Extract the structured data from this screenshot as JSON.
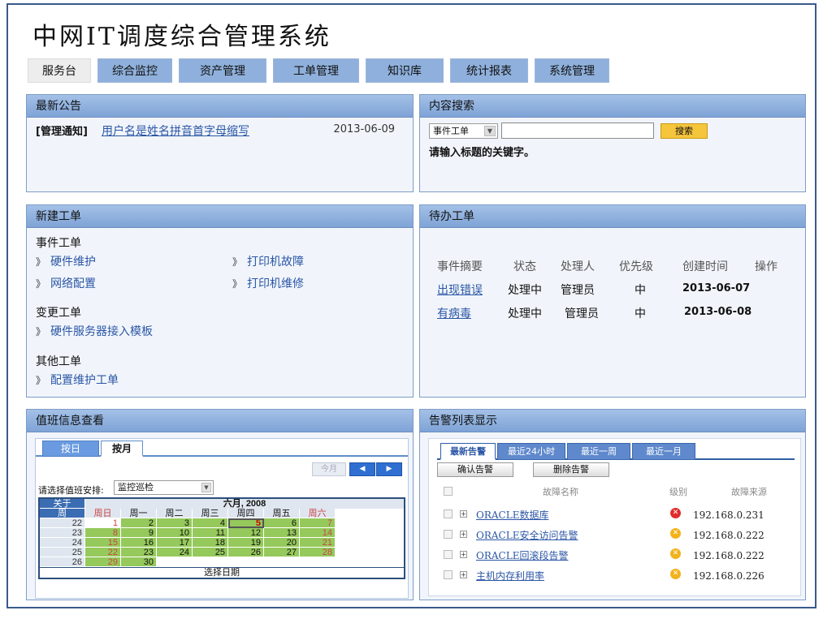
{
  "app_title": "中网IT调度综合管理系统",
  "nav": [
    "服务台",
    "综合监控",
    "资产管理",
    "工单管理",
    "知识库",
    "统计报表",
    "系统管理"
  ],
  "notice": {
    "title": "最新公告",
    "tag": "[管理通知]",
    "link": "用户名是姓名拼音首字母缩写",
    "date": "2013-06-09"
  },
  "search": {
    "title": "内容搜索",
    "select": "事件工单",
    "button": "搜索",
    "hint": "请输入标题的关键字。",
    "value": ""
  },
  "new_ticket": {
    "title": "新建工单",
    "groups": [
      {
        "title": "事件工单",
        "items": [
          "硬件维护",
          "打印机故障",
          "网络配置",
          "打印机维修"
        ]
      },
      {
        "title": "变更工单",
        "items": [
          "硬件服务器接入模板"
        ]
      },
      {
        "title": "其他工单",
        "items": [
          "配置维护工单"
        ]
      }
    ],
    "bullet": "》"
  },
  "todo": {
    "title": "待办工单",
    "headers": [
      "事件摘要",
      "状态",
      "处理人",
      "优先级",
      "创建时间",
      "操作"
    ],
    "rows": [
      {
        "summary": "出现错误",
        "status": "处理中",
        "handler": "管理员",
        "priority": "中",
        "created": "2013-06-07"
      },
      {
        "summary": "有病毒",
        "status": "处理中",
        "handler": "管理员",
        "priority": "中",
        "created": "2013-06-08"
      }
    ]
  },
  "duty": {
    "title": "值班信息查看",
    "tabs": [
      "按日",
      "按月"
    ],
    "today_btn": "今月",
    "prev": "◀",
    "next": "▶",
    "select_label": "请选择值班安排:",
    "select_value": "监控巡检",
    "cal_close": "关于",
    "cal_month": "六月, 2008",
    "cal_week_label": "周",
    "weekdays": [
      "周日",
      "周一",
      "周二",
      "周三",
      "周四",
      "周五",
      "周六"
    ],
    "weeks": [
      {
        "wk": "22",
        "days": [
          "1",
          "2",
          "3",
          "4",
          "5",
          "6",
          "7"
        ]
      },
      {
        "wk": "23",
        "days": [
          "8",
          "9",
          "10",
          "11",
          "12",
          "13",
          "14"
        ]
      },
      {
        "wk": "24",
        "days": [
          "15",
          "16",
          "17",
          "18",
          "19",
          "20",
          "21"
        ]
      },
      {
        "wk": "25",
        "days": [
          "22",
          "23",
          "24",
          "25",
          "26",
          "27",
          "28"
        ]
      },
      {
        "wk": "26",
        "days": [
          "29",
          "30",
          "",
          "",
          "",
          "",
          ""
        ]
      }
    ],
    "today": "5",
    "footer": "选择日期"
  },
  "alarm": {
    "title": "告警列表显示",
    "tabs": [
      "最新告警",
      "最近24小时",
      "最近一周",
      "最近一月"
    ],
    "btn_confirm": "确认告警",
    "btn_delete": "删除告警",
    "headers": [
      "故障名称",
      "级别",
      "故障来源"
    ],
    "rows": [
      {
        "name": "ORACLE数据库",
        "level": "red",
        "source": "192.168.0.231"
      },
      {
        "name": "ORACLE安全访问告警",
        "level": "yellow",
        "source": "192.168.0.222"
      },
      {
        "name": "ORACLE回滚段告警",
        "level": "yellow",
        "source": "192.168.0.222"
      },
      {
        "name": "主机内存利用率",
        "level": "yellow",
        "source": "192.168.0.226"
      }
    ]
  }
}
